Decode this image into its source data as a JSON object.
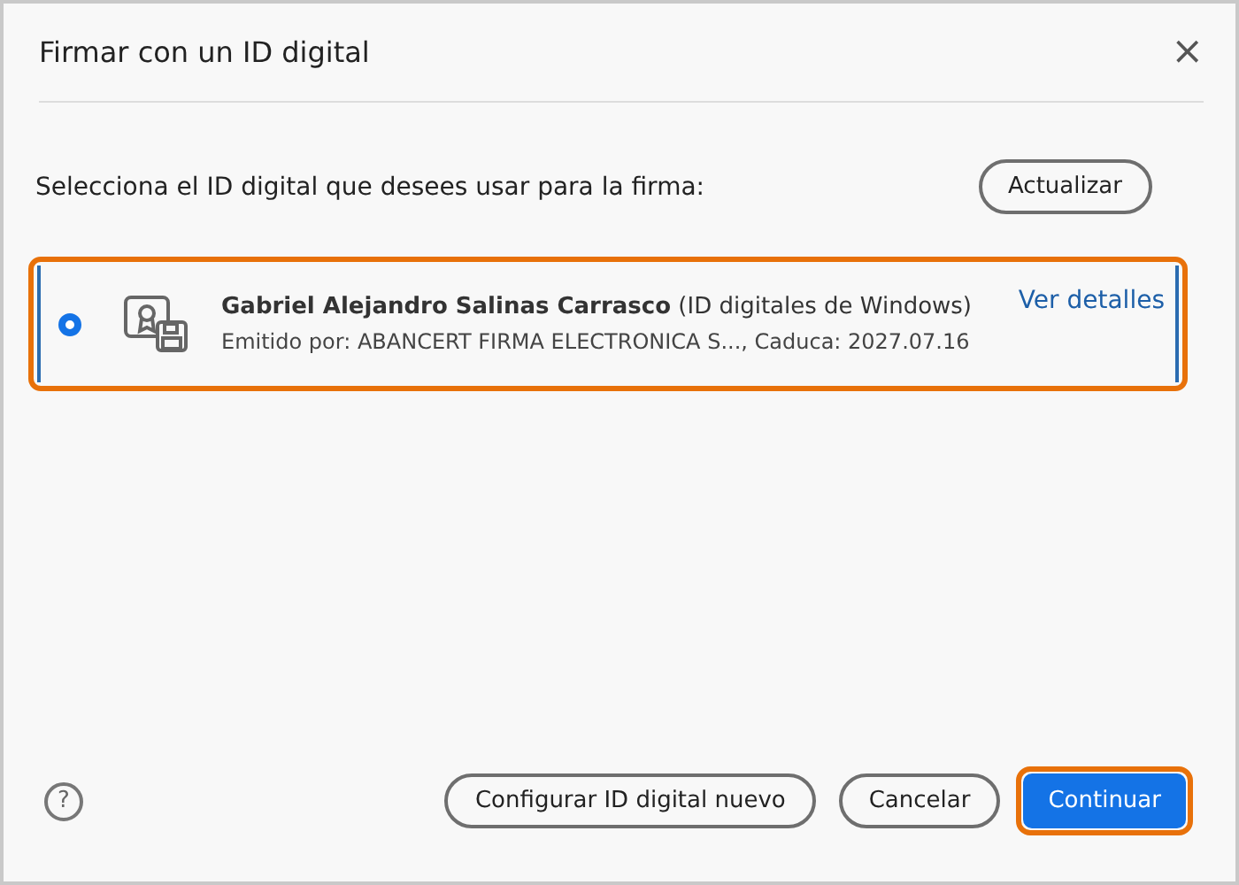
{
  "dialog": {
    "title": "Firmar con un ID digital",
    "close": "×"
  },
  "prompt": "Selecciona el ID digital que desees usar para la firma:",
  "refresh_button": {
    "label": "Actualizar"
  },
  "digital_ids": [
    {
      "name": "Gabriel Alejandro Salinas Carrasco",
      "store": "(ID digitales de Windows)",
      "details": "Emitido por: ABANCERT FIRMA ELECTRONICA S..., Caduca: 2027.07.16",
      "link": "Ver detalles",
      "selected": true,
      "highlighted": true
    }
  ],
  "help": "?",
  "buttons": [
    {
      "label": "Configurar ID digital nuevo",
      "kind": "secondary",
      "highlighted": false
    },
    {
      "label": "Cancelar",
      "kind": "secondary",
      "highlighted": false
    },
    {
      "label": "Continuar",
      "kind": "primary",
      "highlighted": true
    }
  ]
}
